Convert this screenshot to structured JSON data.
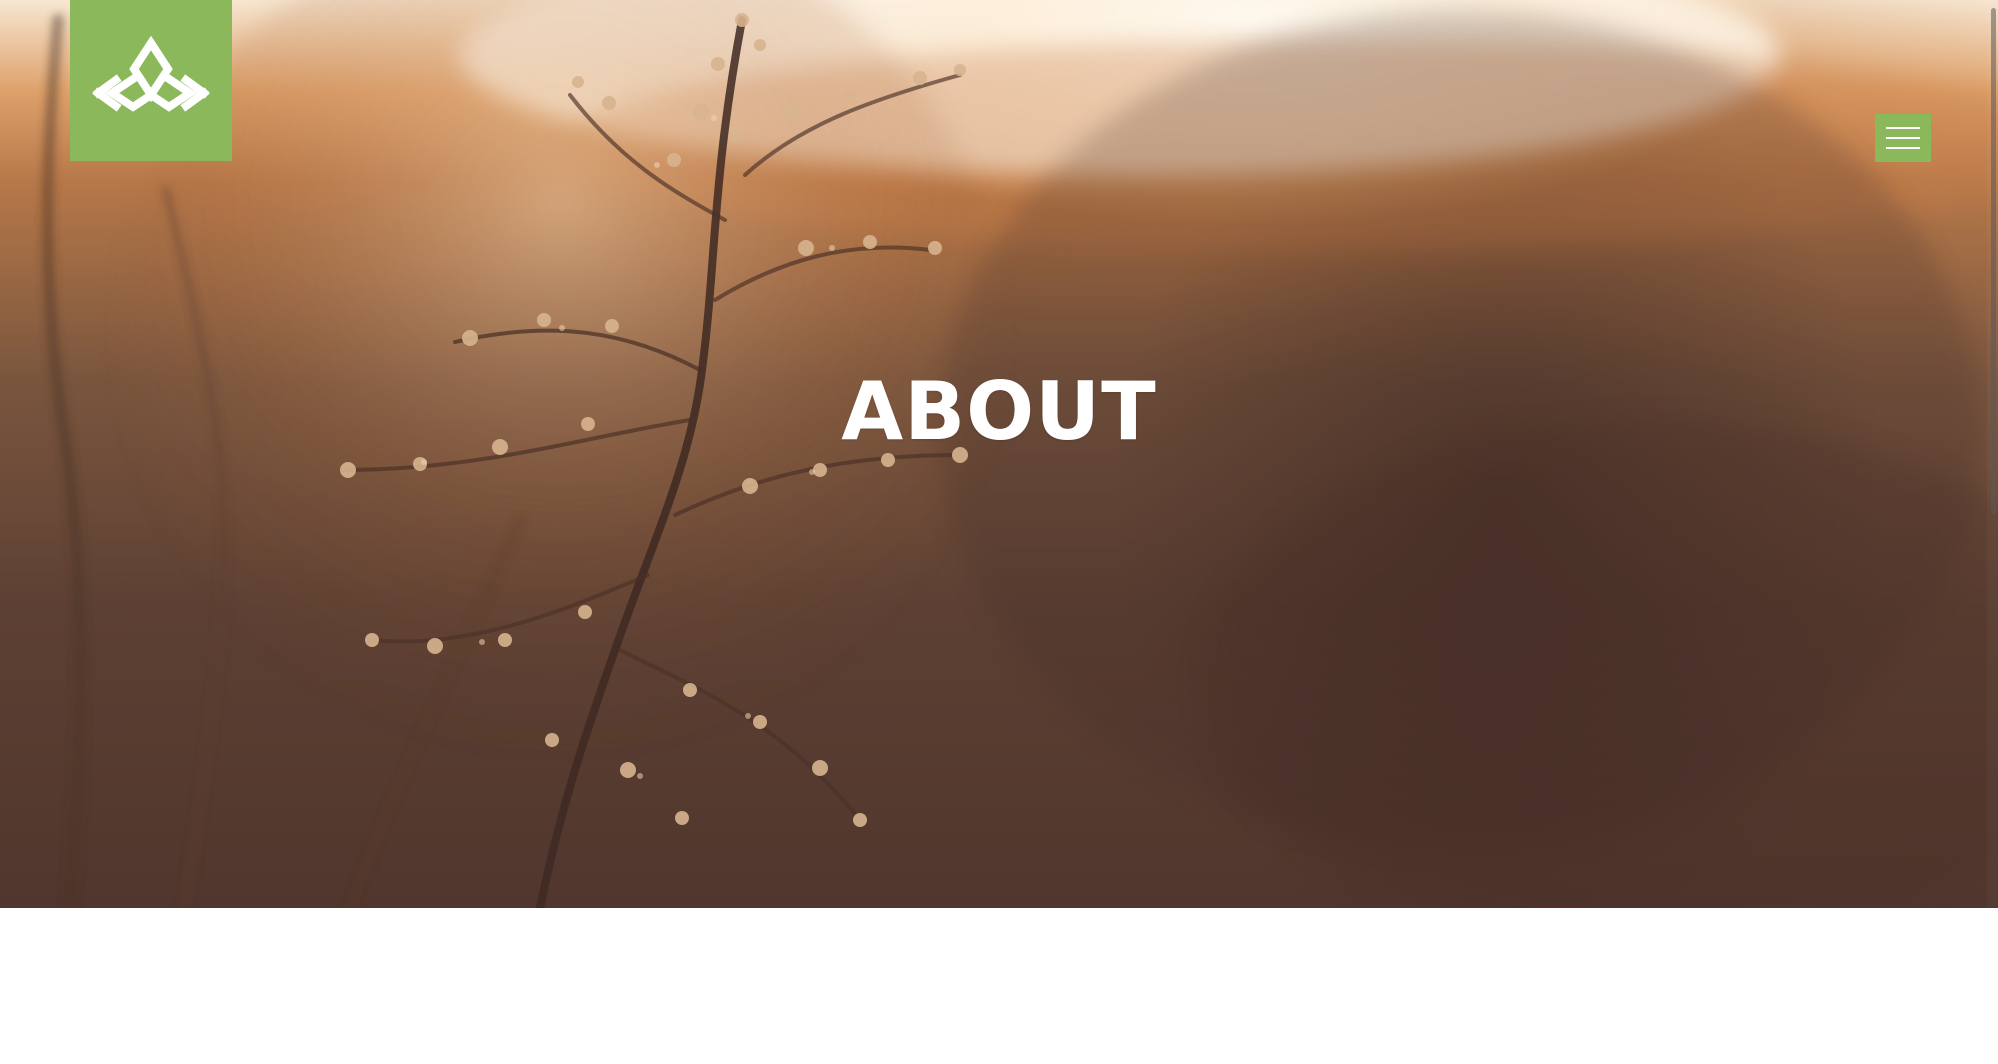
{
  "hero": {
    "title": "ABOUT"
  },
  "header": {
    "logo_icon": "lotus-logo-icon",
    "menu_icon": "hamburger-menu-icon"
  },
  "colors": {
    "brand_green": "#8ab85b",
    "hero_title": "#ffffff",
    "page_background": "#ffffff"
  },
  "background": {
    "subject": "dried-plant-sunset"
  }
}
